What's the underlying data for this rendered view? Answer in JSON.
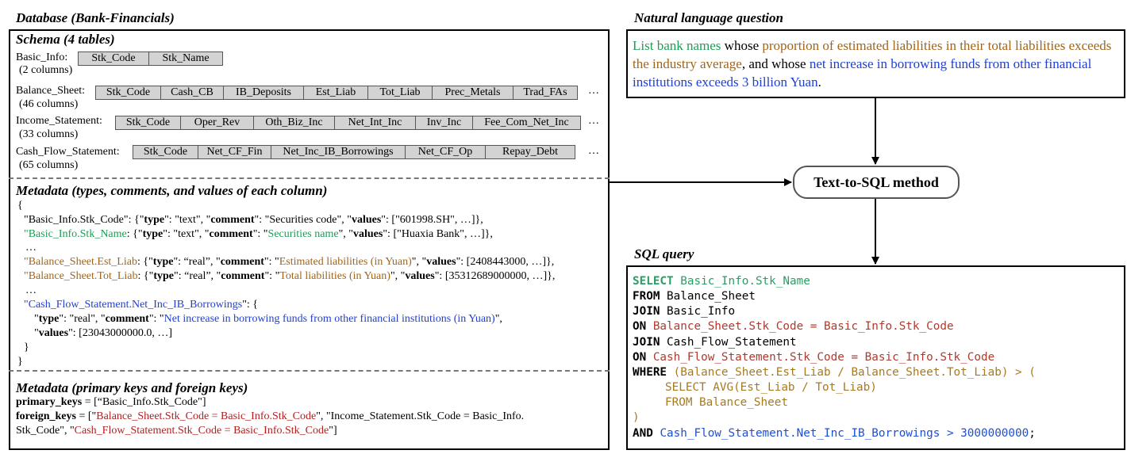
{
  "left": {
    "title": "Database (Bank-Financials)",
    "schema_title": "Schema (4 tables)",
    "tables": [
      {
        "name": "Basic_Info:",
        "columns_count": "(2 columns)",
        "cells": [
          "Stk_Code",
          "Stk_Name"
        ],
        "more": ""
      },
      {
        "name": "Balance_Sheet:",
        "columns_count": "(46 columns)",
        "cells": [
          "Stk_Code",
          "Cash_CB",
          "IB_Deposits",
          "Est_Liab",
          "Tot_Liab",
          "Prec_Metals",
          "Trad_FAs"
        ],
        "more": "…"
      },
      {
        "name": "Income_Statement:",
        "columns_count": "(33 columns)",
        "cells": [
          "Stk_Code",
          "Oper_Rev",
          "Oth_Biz_Inc",
          "Net_Int_Inc",
          "Inv_Inc",
          "Fee_Com_Net_Inc"
        ],
        "more": "…"
      },
      {
        "name": "Cash_Flow_Statement:",
        "columns_count": "(65 columns)",
        "cells": [
          "Stk_Code",
          "Net_CF_Fin",
          "Net_Inc_IB_Borrowings",
          "Net_CF_Op",
          "Repay_Debt"
        ],
        "more": "…"
      }
    ],
    "metadata_title": "Metadata (types, comments, and values of each column)",
    "metadata_lines": {
      "open": "{",
      "l1": {
        "key": "\"Basic_Info.Stk_Code\"",
        "rest1": ": {\"",
        "t": "type",
        "rest2": "\": \"text\", \"",
        "c": "comment",
        "rest3": "\": \"",
        "comment": "Securities code",
        "rest4": "\", \"",
        "v": "values",
        "rest5": "\": [\"601998.SH\", …]},"
      },
      "l2": {
        "key": "\"Basic_Info.Stk_Name",
        "rest1": ": {\"",
        "t": "type",
        "rest2": "\": \"text\", \"",
        "c": "comment",
        "rest3": "\": \"",
        "comment": "Securities name",
        "rest4": "\", \"",
        "v": "values",
        "rest5": "\": [\"Huaxia Bank\", …]},"
      },
      "dots1": "…",
      "l3": {
        "key": "\"Balance_Sheet.Est_Liab",
        "rest1": ": {\"",
        "t": "type",
        "rest2": "\": “real”, \"",
        "c": "comment",
        "rest3": "\": \"",
        "comment": "Estimated liabilities (in Yuan)",
        "rest4": "\",  \"",
        "v": "values",
        "rest5": "\": [2408443000, …]},"
      },
      "l4": {
        "key": "\"Balance_Sheet.Tot_Liab",
        "rest1": ": {\"",
        "t": "type",
        "rest2": "\": “real”, \"",
        "c": "comment",
        "rest3": "\": \"",
        "comment": "Total liabilities (in Yuan)",
        "rest4": "\",  \"",
        "v": "values",
        "rest5": "\": [35312689000000, …]},"
      },
      "dots2": "…",
      "l5": {
        "key": "\"Cash_Flow_Statement.Net_Inc_IB_Borrowings",
        "rest": "\": {"
      },
      "l6": {
        "pre": "\"",
        "t": "type",
        "rest2": "\": \"real\",  \"",
        "c": "comment",
        "rest3": "\": \"",
        "comment": "Net increase in borrowing funds from other financial institutions (in Yuan)",
        "rest4": "\","
      },
      "l7": {
        "pre": "\"",
        "v": "values",
        "rest": "\": [23043000000.0, …]"
      },
      "close_inner": "}",
      "close": "}"
    },
    "keys_title": "Metadata (primary keys and foreign keys)",
    "primary_keys_label": "primary_keys",
    "primary_keys_value": " = [“Basic_Info.Stk_Code\"]",
    "foreign_keys_label": "foreign_keys",
    "fk_pre": " = [\"",
    "fk1": "Balance_Sheet.Stk_Code = Basic_Info.Stk_Code",
    "fk_mid": "\", \"Income_Statement.Stk_Code = Basic_Info.",
    "fk_line2_pre": "Stk_Code\", \"",
    "fk2": "Cash_Flow_Statement.Stk_Code = Basic_Info.Stk_Code",
    "fk_end": "\"]"
  },
  "right": {
    "question_title": "Natural language question",
    "question": {
      "p1": "List bank names",
      "p2": " whose ",
      "p3": "proportion of estimated liabilities in their total liabilities exceeds the industry average",
      "p4": ", and whose ",
      "p5": "net increase in borrowing funds from other financial institutions exceeds 3 billion Yuan",
      "p6": "."
    },
    "method_label": "Text-to-SQL method",
    "sql_title": "SQL query",
    "sql": {
      "select_kw": "SELECT",
      "select_col": "Basic_Info.Stk_Name",
      "from_kw": "FROM",
      "from_tbl": "Balance_Sheet",
      "join1_kw": "JOIN",
      "join1_tbl": "Basic_Info",
      "on1_kw": "ON",
      "on1_cond": "Balance_Sheet.Stk_Code = Basic_Info.Stk_Code",
      "join2_kw": "JOIN",
      "join2_tbl": "Cash_Flow_Statement",
      "on2_kw": "ON",
      "on2_cond": "Cash_Flow_Statement.Stk_Code = Basic_Info.Stk_Code",
      "where_kw": "WHERE",
      "where_cond": "(Balance_Sheet.Est_Liab / Balance_Sheet.Tot_Liab) > (",
      "sub1": "SELECT AVG(Est_Liab / Tot_Liab)",
      "sub2": "FROM Balance_Sheet",
      "close_paren": ")",
      "and_kw": "AND",
      "and_cond": "Cash_Flow_Statement.Net_Inc_IB_Borrowings > 3000000000",
      "semicolon": ";"
    }
  }
}
